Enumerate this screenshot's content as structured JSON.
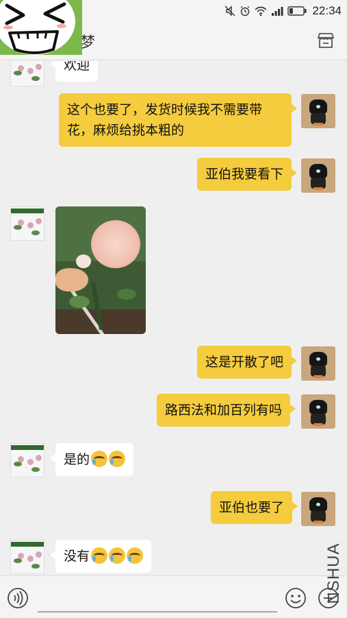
{
  "status_bar": {
    "time": "22:34",
    "icons": [
      "mute-icon",
      "alarm-icon",
      "wifi-icon",
      "signal-icon",
      "battery-icon"
    ],
    "battery_level": 0.25
  },
  "title_bar": {
    "title": "梦",
    "right_icon": "shop-icon"
  },
  "messages": [
    {
      "side": "other",
      "type": "text",
      "text": "欢迎"
    },
    {
      "side": "self",
      "type": "text",
      "text": "这个也要了，发货时候我不需要带花，麻烦给挑本粗的"
    },
    {
      "side": "self",
      "type": "text",
      "text": "亚伯我要看下"
    },
    {
      "side": "other",
      "type": "image",
      "description": "pink-rose-photo"
    },
    {
      "side": "self",
      "type": "text",
      "text": "这是开散了吧"
    },
    {
      "side": "self",
      "type": "text",
      "text": "路西法和加百列有吗"
    },
    {
      "side": "other",
      "type": "text",
      "text": "是的",
      "emojis": 2
    },
    {
      "side": "self",
      "type": "text",
      "text": "亚伯也要了"
    },
    {
      "side": "other",
      "type": "text",
      "text": "没有",
      "emojis": 3
    }
  ],
  "input_bar": {
    "left_icon": "voice-icon",
    "right_icons": [
      "emoji-icon",
      "plus-icon"
    ]
  },
  "watermark": "NSHUA",
  "colors": {
    "self_bubble": "#f4cc3e",
    "other_bubble": "#ffffff",
    "background": "#efefef",
    "sticker_green": "#7cb84a"
  }
}
